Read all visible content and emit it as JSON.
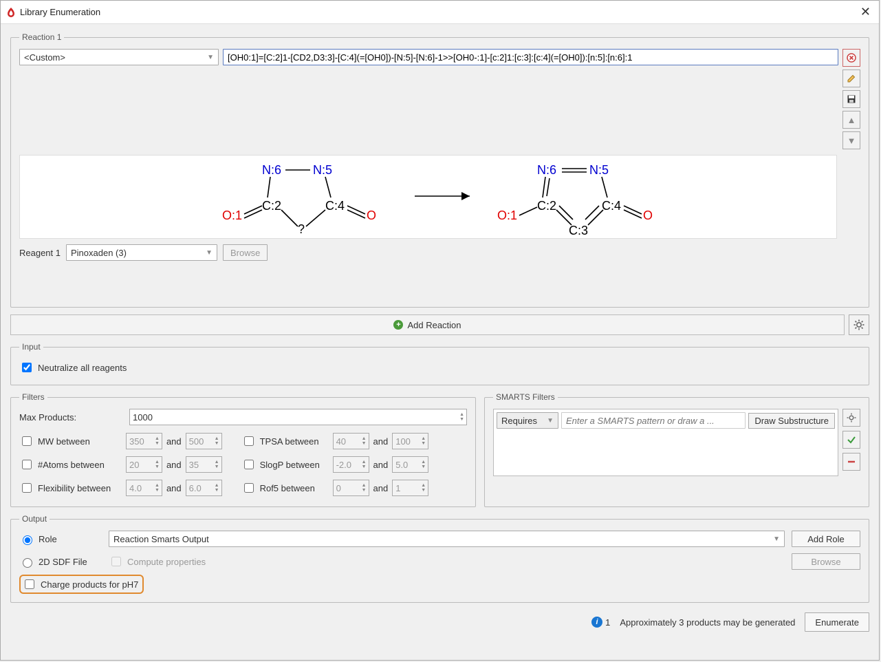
{
  "window": {
    "title": "Library Enumeration"
  },
  "reaction": {
    "legend": "Reaction 1",
    "template_select": "<Custom>",
    "smarts": "[OH0:1]=[C:2]1-[CD2,D3:3]-[C:4](=[OH0])-[N:5]-[N:6]-1>>[OH0-:1]-[c:2]1:[c:3]:[c:4](=[OH0]):[n:5]:[n:6]:1",
    "reagent_label": "Reagent 1",
    "reagent_value": "Pinoxaden (3)",
    "browse": "Browse",
    "canvas": {
      "left": {
        "o1": "O:1",
        "c2": "C:2",
        "q": "?",
        "c4": "C:4",
        "o": "O",
        "n6": "N:6",
        "n5": "N:5"
      },
      "right": {
        "o1": "O:1",
        "c2": "C:2",
        "c3": "C:3",
        "c4": "C:4",
        "o": "O",
        "n6": "N:6",
        "n5": "N:5"
      }
    }
  },
  "add_reaction": "Add Reaction",
  "input_group": {
    "legend": "Input",
    "neutralize": "Neutralize all reagents"
  },
  "filters": {
    "legend": "Filters",
    "max_products_label": "Max Products:",
    "max_products_value": "1000",
    "and": "and",
    "mw": {
      "label": "MW between",
      "lo": "350",
      "hi": "500"
    },
    "atoms": {
      "label": "#Atoms between",
      "lo": "20",
      "hi": "35"
    },
    "flex": {
      "label": "Flexibility between",
      "lo": "4.0",
      "hi": "6.0"
    },
    "tpsa": {
      "label": "TPSA between",
      "lo": "40",
      "hi": "100"
    },
    "slogp": {
      "label": "SlogP between",
      "lo": "-2.0",
      "hi": "5.0"
    },
    "rof5": {
      "label": "Rof5 between",
      "lo": "0",
      "hi": "1"
    }
  },
  "smarts_filters": {
    "legend": "SMARTS Filters",
    "mode": "Requires",
    "placeholder": "Enter a SMARTS pattern or draw a ...",
    "draw": "Draw Substructure"
  },
  "output": {
    "legend": "Output",
    "role": "Role",
    "role_value": "Reaction Smarts Output",
    "add_role": "Add Role",
    "sdf": "2D SDF File",
    "compute": "Compute properties",
    "browse": "Browse",
    "charge": "Charge products for pH7"
  },
  "footer": {
    "count": "1",
    "msg": "Approximately 3 products may be generated",
    "enumerate": "Enumerate"
  }
}
